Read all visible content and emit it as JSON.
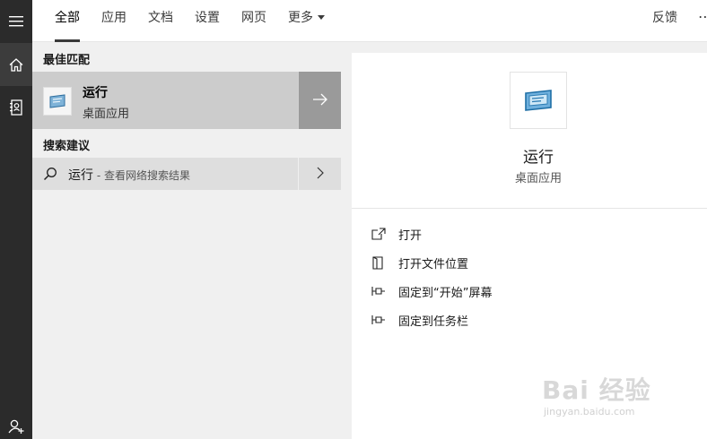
{
  "rail": {
    "items": [
      {
        "name": "menu",
        "icon": "hamburger-icon"
      },
      {
        "name": "home",
        "icon": "home-icon"
      },
      {
        "name": "notebook",
        "icon": "notebook-icon"
      },
      {
        "name": "account",
        "icon": "account-icon"
      }
    ]
  },
  "tabs": {
    "all": "全部",
    "apps": "应用",
    "documents": "文档",
    "settings": "设置",
    "web": "网页",
    "more": "更多",
    "feedback": "反馈",
    "overflow": "⋯"
  },
  "results": {
    "best_match_title": "最佳匹配",
    "best_match": {
      "name": "运行",
      "type": "桌面应用",
      "icon": "run-icon",
      "arrow_icon": "arrow-right-icon"
    },
    "suggestions_title": "搜索建议",
    "suggestion": {
      "query": "运行",
      "hint": " - 查看网络搜索结果",
      "icon": "search-icon",
      "arrow_icon": "chevron-right-icon"
    }
  },
  "preview": {
    "app_name": "运行",
    "app_type": "桌面应用",
    "actions": [
      {
        "label": "打开",
        "icon": "open-icon"
      },
      {
        "label": "打开文件位置",
        "icon": "file-location-icon"
      },
      {
        "label": "固定到“开始”屏幕",
        "icon": "pin-icon"
      },
      {
        "label": "固定到任务栏",
        "icon": "pin-icon"
      }
    ]
  },
  "watermark": {
    "main": "Bai 经验",
    "sub": "jingyan.baidu.com"
  },
  "colors": {
    "rail": "#2b2b2b",
    "pane": "#f0f0f0",
    "best_match_bg": "#cccccc",
    "arrow_bg": "#9a9a9a",
    "suggest_bg": "#dedede"
  }
}
